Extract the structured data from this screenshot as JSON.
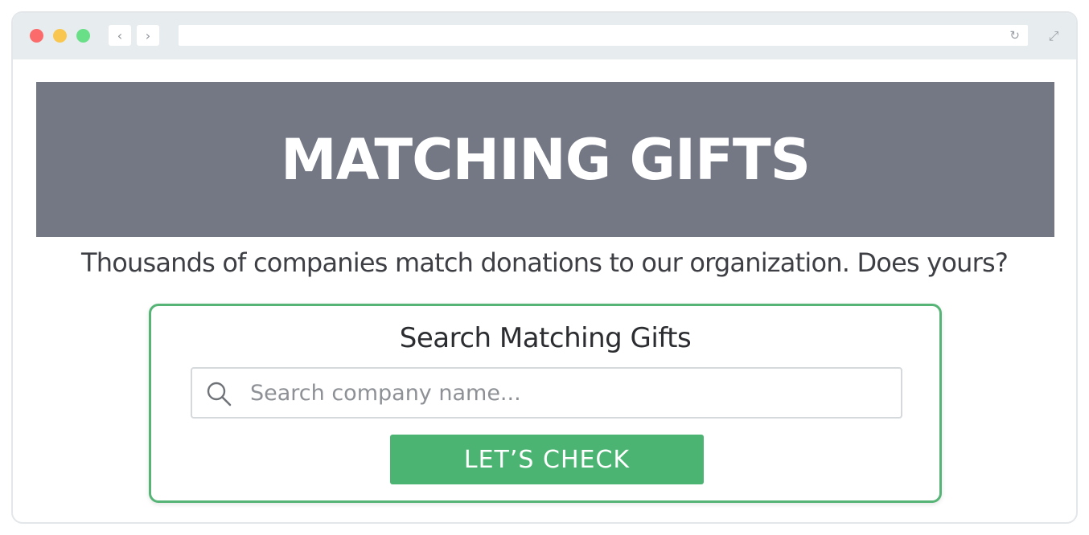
{
  "browser": {
    "back_label": "‹",
    "forward_label": "›",
    "reload_glyph": "↻",
    "expand_glyph": "⤢",
    "address": ""
  },
  "hero": {
    "title": "MATCHING GIFTS",
    "background_color": "#747885"
  },
  "tagline": "Thousands of companies match donations to our organization. Does yours?",
  "search_card": {
    "title": "Search Matching Gifts",
    "search_placeholder": "Search company name...",
    "search_value": "",
    "button_label": "LET’S CHECK",
    "accent_color": "#4bb473",
    "icon": "search-icon"
  }
}
